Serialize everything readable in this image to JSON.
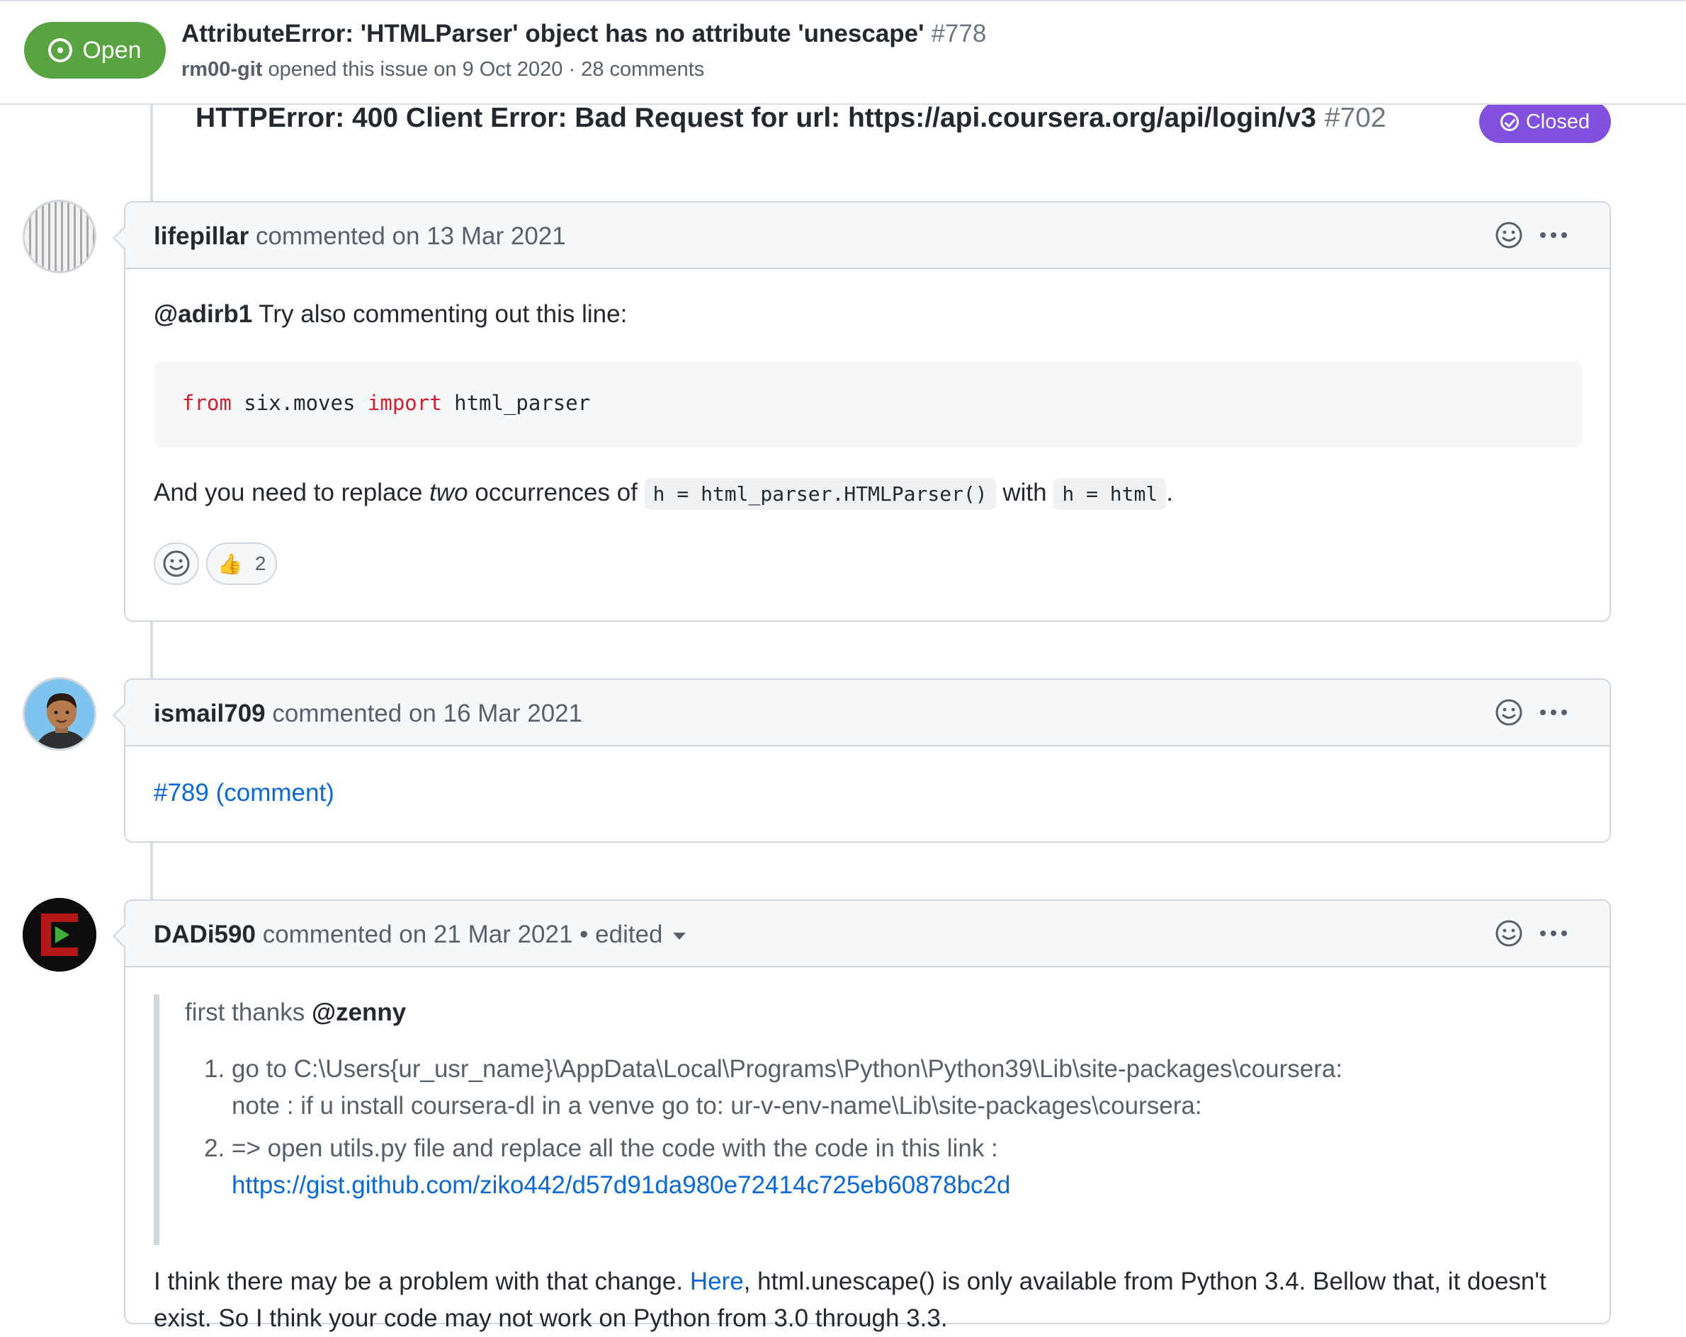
{
  "issue": {
    "state": "Open",
    "title": "AttributeError: 'HTMLParser' object has no attribute 'unescape'",
    "number": "#778",
    "author": "rm00-git",
    "meta": "opened this issue on 9 Oct 2020 · 28 comments"
  },
  "reference": {
    "title": "HTTPError: 400 Client Error: Bad Request for url: https://api.coursera.org/api/login/v3",
    "number": "#702",
    "state": "Closed"
  },
  "comments": [
    {
      "author": "lifepillar",
      "date": "commented on 13 Mar 2021",
      "mention": "@adirb1",
      "text1": " Try also commenting out this line:",
      "code": {
        "kw1": "from",
        "mod": " six.moves ",
        "kw2": "import",
        "name": " html_parser"
      },
      "text2a": "And you need to replace ",
      "text2b": "two",
      "text2c": " occurrences of ",
      "code2": "h = html_parser.HTMLParser()",
      "text2d": " with ",
      "code3": "h = html",
      "text2e": ".",
      "reaction_count": "2"
    },
    {
      "author": "ismail709",
      "date": "commented on 16 Mar 2021",
      "link": "#789 (comment)"
    },
    {
      "author": "DADi590",
      "date": "commented on 21 Mar 2021 • edited",
      "quote_intro": "first thanks ",
      "quote_mention": "@zenny",
      "steps": [
        {
          "line1": "go to C:\\Users{ur_usr_name}\\AppData\\Local\\Programs\\Python\\Python39\\Lib\\site-packages\\coursera:",
          "line2": "note : if u install coursera-dl in a venve go to: ur-v-env-name\\Lib\\site-packages\\coursera:"
        },
        {
          "line1": "=> open utils.py file and replace all the code with the code in this link :",
          "link": "https://gist.github.com/ziko442/d57d91da980e72414c725eb60878bc2d"
        }
      ],
      "para_a": "I think there may be a problem with that change. ",
      "para_link": "Here",
      "para_b": ", html.unescape() is only available from Python 3.4. Bellow that, it doesn't",
      "para_c": "exist. So I think your code may not work on Python from 3.0 through 3.3."
    }
  ],
  "colors": {
    "open": "#57a440",
    "closed": "#8250df",
    "link": "#0969da",
    "keyword": "#cf222e"
  },
  "icons": [
    "issue-open-icon",
    "check-circle-icon",
    "smiley-icon",
    "kebab-icon",
    "thumbs-up-icon",
    "caret-down-icon"
  ]
}
